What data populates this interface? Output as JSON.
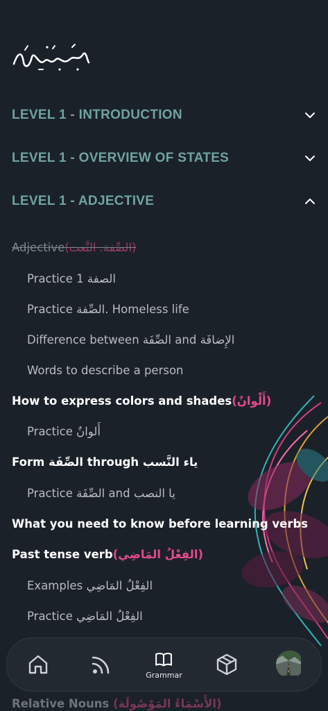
{
  "logo_text": "وقل رب زدني علما",
  "sections": [
    {
      "title": "LEVEL 1 - INTRODUCTION",
      "expanded": false,
      "icon": "chevron-down-icon"
    },
    {
      "title": "LEVEL 1 - OVERVIEW OF STATES",
      "expanded": false,
      "icon": "chevron-down-icon"
    },
    {
      "title": "LEVEL 1 - ADJECTIVE",
      "expanded": true,
      "icon": "chevron-up-icon"
    }
  ],
  "lessons": [
    {
      "text": "Adjective ",
      "accent": "(الصِّفة. النَّعت)",
      "style": "done"
    },
    {
      "text": "Practice 1 الصفة",
      "accent": "",
      "style": "sub"
    },
    {
      "text": "Practice الصِّفة. Homeless life",
      "accent": "",
      "style": "sub"
    },
    {
      "text": "Difference between الصِّفَة and الإِضافَة",
      "accent": "",
      "style": "sub"
    },
    {
      "text": "Words to describe a person",
      "accent": "",
      "style": "sub"
    },
    {
      "text": "How to express colors and shades ",
      "accent": "(أَلْوانٌ)",
      "style": "main"
    },
    {
      "text": "Practice أَلوانٌ",
      "accent": "",
      "style": "sub"
    },
    {
      "text": "Form الصِّفَة through ياء النَّسب",
      "accent": "",
      "style": "main"
    },
    {
      "text": "Practice الصِّفَة and يا النصب",
      "accent": "",
      "style": "sub"
    },
    {
      "text": "What you need to know before learning verbs",
      "accent": "",
      "style": "main"
    },
    {
      "text": "Past tense verb ",
      "accent": "(الفِعْلُ المَاضِي)",
      "style": "main"
    },
    {
      "text": "Examples الفِعْلُ المَاضِي",
      "accent": "",
      "style": "sub"
    },
    {
      "text": "Practice الفِعْلُ المَاضِي",
      "accent": "",
      "style": "sub"
    }
  ],
  "partial_item": {
    "text": "Relative Nouns ",
    "accent": "(الأَسْمَاءُ المَوْصُولَة)"
  },
  "nav": {
    "home_icon": "home-icon",
    "feed_icon": "rss-feed-icon",
    "grammar_icon": "book-icon",
    "grammar_label": "Grammar",
    "cube_icon": "cube-icon",
    "avatar_icon": "avatar"
  },
  "colors": {
    "background": "#1b2129",
    "section": "#6fa3a0",
    "accent": "#e24a8f"
  }
}
